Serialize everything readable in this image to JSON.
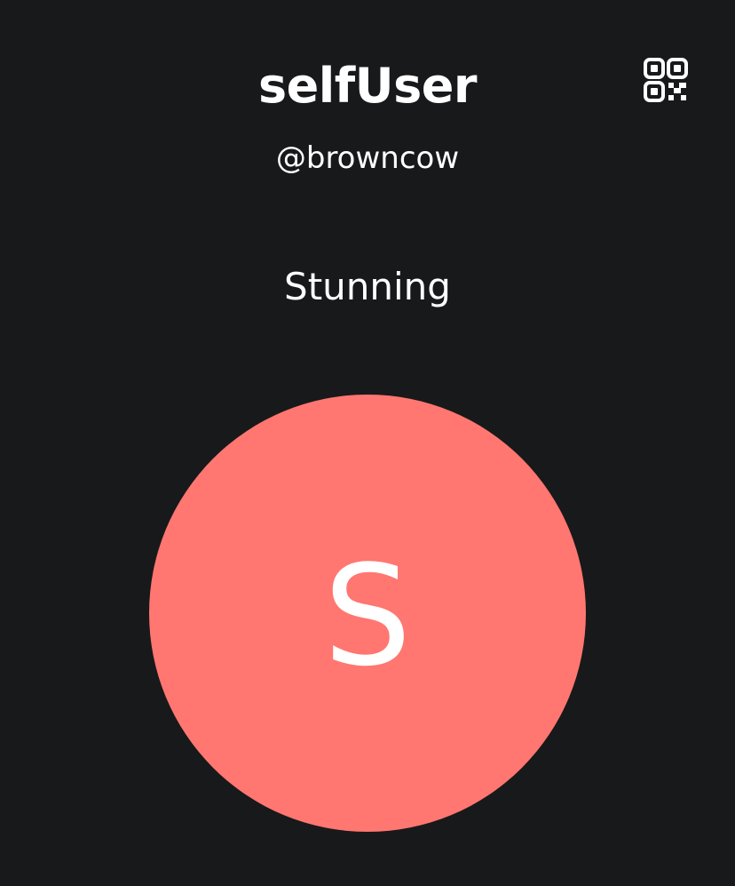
{
  "profile": {
    "display_name": "selfUser",
    "username": "@browncow",
    "status": "Stunning",
    "avatar": {
      "initial": "S",
      "color": "#ff7770"
    }
  },
  "header": {
    "qr_button_icon": "qr-code-icon"
  },
  "theme": {
    "background": "#18191b",
    "text": "#ffffff"
  }
}
